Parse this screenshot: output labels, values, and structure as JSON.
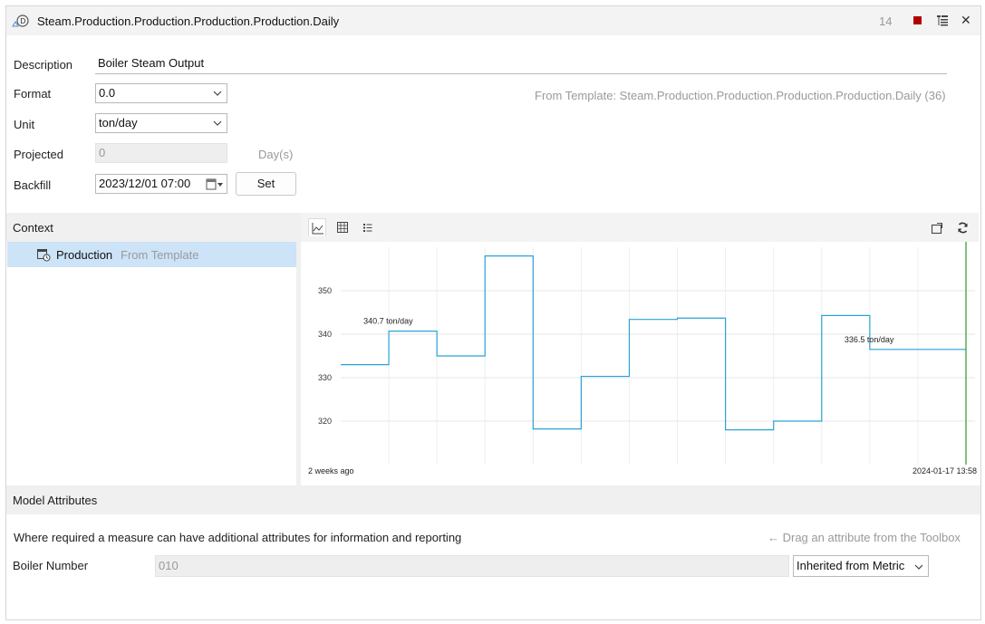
{
  "window": {
    "title": "Steam.Production.Production.Production.Production.Daily",
    "count": "14",
    "icons": [
      "measure-icon",
      "stop-icon",
      "tree-icon",
      "close-icon"
    ]
  },
  "form": {
    "description_label": "Description",
    "description_value": "Boiler Steam Output",
    "format_label": "Format",
    "format_value": "0.0",
    "unit_label": "Unit",
    "unit_value": "ton/day",
    "projected_label": "Projected",
    "projected_value": "0",
    "projected_unit": "Day(s)",
    "backfill_label": "Backfill",
    "backfill_value": "2023/12/01 07:00",
    "set_label": "Set",
    "template_hint": "From Template: Steam.Production.Production.Production.Production.Daily (36)"
  },
  "context": {
    "header": "Context",
    "item_label": "Production",
    "item_suffix": "From Template"
  },
  "chart_toolbar": {
    "tabs": [
      "line-chart-icon",
      "table-icon",
      "list-icon"
    ],
    "actions": [
      "popout-icon",
      "refresh-icon"
    ]
  },
  "chart_data": {
    "type": "line",
    "step": true,
    "x": [
      0,
      1,
      2,
      3,
      4,
      5,
      6,
      7,
      8,
      9,
      10,
      11,
      12
    ],
    "values": [
      333,
      340.7,
      335,
      358,
      318.2,
      330.3,
      343.4,
      343.7,
      318,
      320,
      344.3,
      336.5,
      336.5
    ],
    "yticks": [
      320,
      330,
      340,
      350
    ],
    "ylim": [
      310,
      360
    ],
    "x_start_label": "2 weeks ago",
    "x_end_label": "2024-01-17 13:58",
    "annotations": [
      {
        "text": "340.7 ton/day",
        "x": 1,
        "y": 340.7
      },
      {
        "text": "336.5 ton/day",
        "x": 11,
        "y": 336.5
      }
    ],
    "series_color": "#29a3d6",
    "now_line_color": "#2a9a2a",
    "grid": true
  },
  "model_attributes": {
    "header": "Model Attributes",
    "description": "Where required a measure can have additional attributes for information and reporting",
    "drag_hint": "← Drag an attribute from the Toolbox",
    "attribute_label": "Boiler Number",
    "attribute_value": "010",
    "inheritance_value": "Inherited from Metric"
  }
}
